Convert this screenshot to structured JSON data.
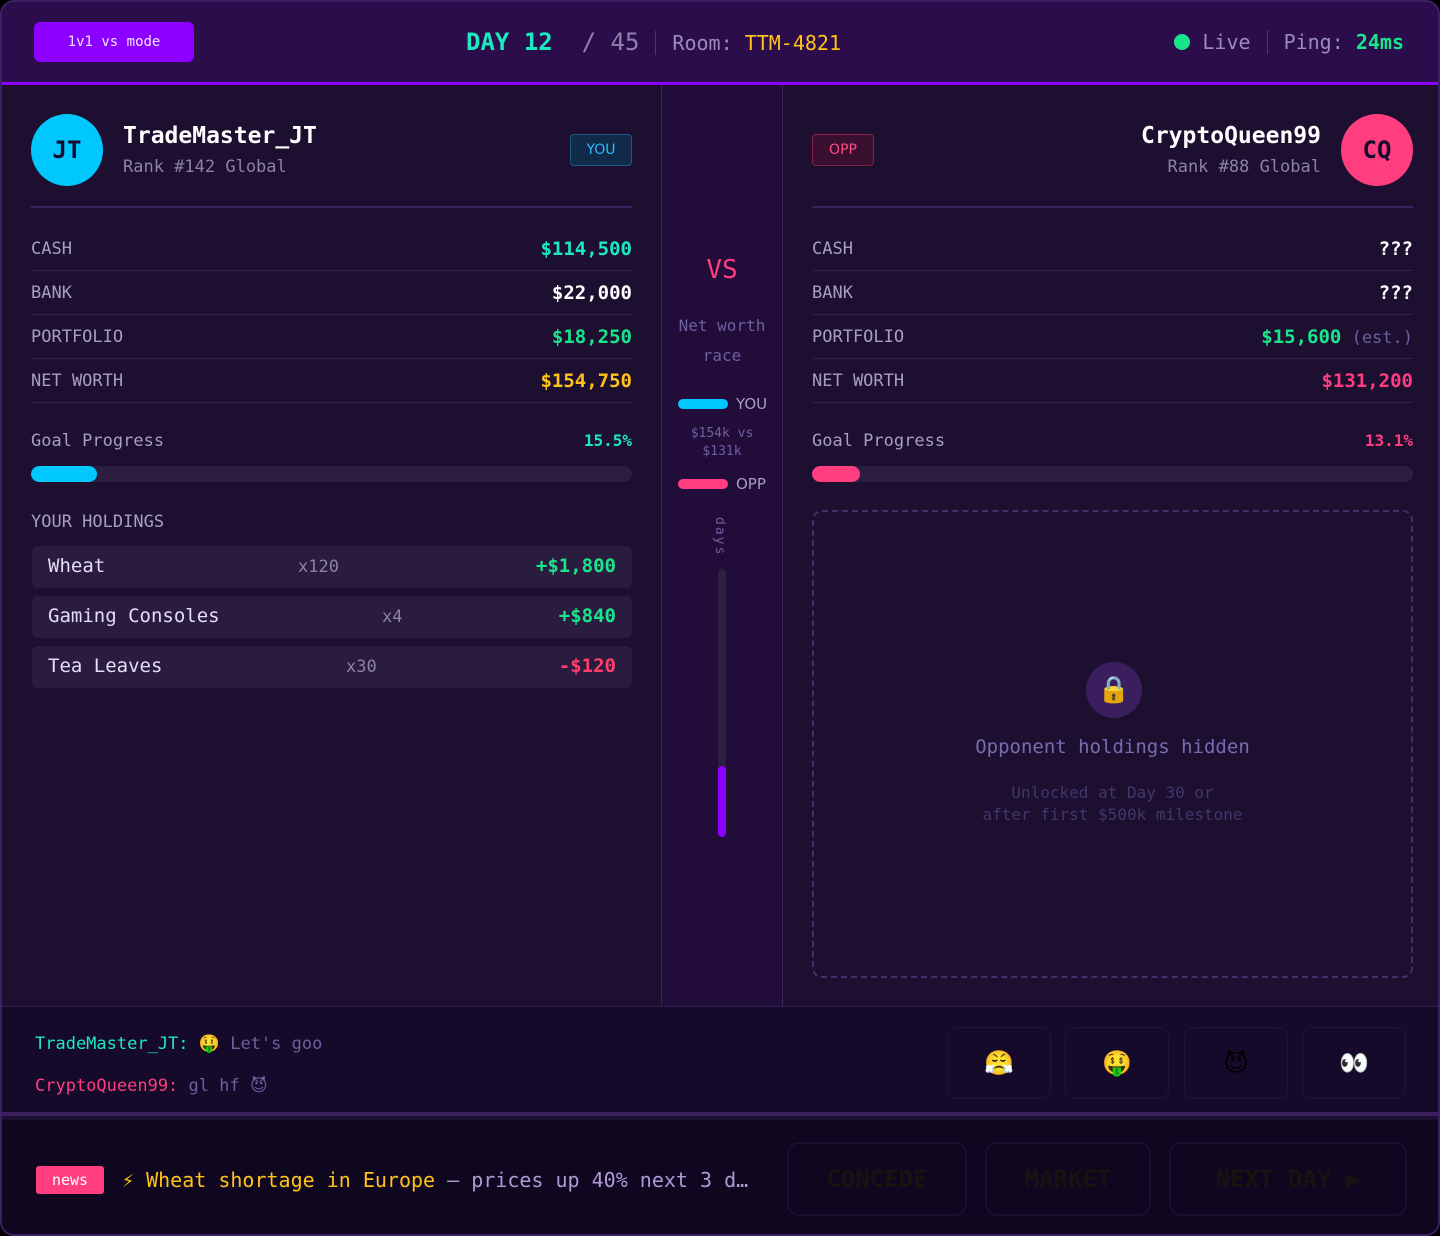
{
  "header": {
    "mode": "1v1 vs mode",
    "day_label": "DAY",
    "day": 12,
    "total_days": 45,
    "room_label": "Room:",
    "room": "TTM-4821",
    "status": "Live",
    "ping_label": "Ping:",
    "ping": "24ms"
  },
  "player": {
    "initials": "JT",
    "name": "TradeMaster_JT",
    "rank": "Rank #142 Global",
    "tag": "YOU",
    "avatar_color": "#00c8ff",
    "stats": [
      {
        "label": "CASH",
        "value": "$114,500",
        "color": "#1de9c0"
      },
      {
        "label": "BANK",
        "value": "$22,000",
        "color": "#ffffff"
      },
      {
        "label": "PORTFOLIO",
        "value": "$18,250",
        "color": "#19e68c"
      },
      {
        "label": "NET WORTH",
        "value": "$154,750",
        "color": "#ffc21a"
      }
    ],
    "goal_label": "Goal Progress",
    "goal": "15.5%",
    "goal_bar_fill": 0.11,
    "holdings_title": "YOUR HOLDINGS",
    "holdings": [
      {
        "name": "Wheat",
        "qty": "x120",
        "gain": "+$1,800",
        "color": "#19e68c"
      },
      {
        "name": "Gaming Consoles",
        "qty": "x4",
        "gain": "+$840",
        "color": "#19e68c"
      },
      {
        "name": "Tea Leaves",
        "qty": "x30",
        "gain": "-$120",
        "color": "#ff3d6e"
      }
    ]
  },
  "opponent": {
    "initials": "CQ",
    "name": "CryptoQueen99",
    "rank": "Rank #88 Global",
    "tag": "OPP",
    "avatar_color": "#ff3d7f",
    "stats": [
      {
        "label": "CASH",
        "value": "???",
        "color": "#ffffff"
      },
      {
        "label": "BANK",
        "value": "???",
        "color": "#ffffff"
      },
      {
        "label": "PORTFOLIO",
        "value": "$15,600",
        "note": "(est.)",
        "color": "#19e68c"
      },
      {
        "label": "NET WORTH",
        "value": "$131,200",
        "color": "#ff3d7f"
      }
    ],
    "goal_label": "Goal Progress",
    "goal": "13.1%",
    "goal_bar_fill": 0.08,
    "locked_title": "Opponent holdings hidden",
    "locked_line1": "Unlocked at Day 30 or",
    "locked_line2": "after first $500k milestone"
  },
  "center": {
    "vs": "VS",
    "race_line1": "Net worth",
    "race_line2": "race",
    "you": "YOU",
    "opp": "OPP",
    "compare_line1": "$154k vs",
    "compare_line2": "$131k",
    "days": "days"
  },
  "chat": {
    "messages": [
      {
        "user": "TradeMaster_JT:",
        "emoji": "🤑",
        "text": "Let's goo"
      },
      {
        "user": "CryptoQueen99:",
        "text": "gl hf",
        "emoji": "😈"
      }
    ],
    "reactions": [
      "😤",
      "🤑",
      "😈",
      "👀"
    ]
  },
  "footer": {
    "news_badge": "news",
    "news_icon": "⚡",
    "headline": "Wheat shortage in Europe",
    "detail": " — prices up 40% next 3 d…",
    "buttons": {
      "concede": "CONCEDE",
      "market": "MARKET",
      "next_day": "NEXT DAY ▶"
    }
  }
}
